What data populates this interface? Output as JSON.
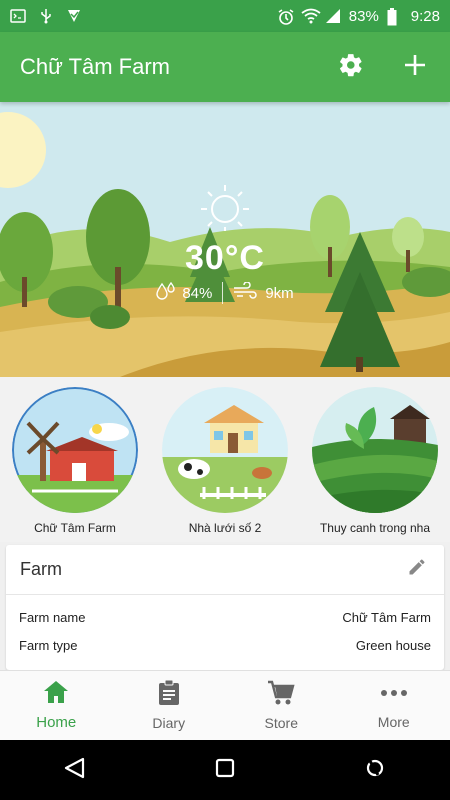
{
  "status_bar": {
    "battery": "83%",
    "time": "9:28",
    "icons": [
      "terminal-icon",
      "usb-icon",
      "download-check-icon",
      "alarm-icon",
      "wifi-icon",
      "signal-icon",
      "battery-icon"
    ]
  },
  "app_bar": {
    "title": "Chữ Tâm Farm",
    "actions": [
      "settings-icon",
      "add-icon"
    ]
  },
  "weather": {
    "temperature": "30°C",
    "humidity": "84%",
    "wind": "9km",
    "condition_icon": "sun-icon"
  },
  "farms": [
    {
      "label": "Chữ Tâm Farm"
    },
    {
      "label": "Nhà lưới số 2"
    },
    {
      "label": "Thuy canh trong nha"
    }
  ],
  "farm_panel": {
    "title": "Farm",
    "rows": [
      {
        "label": "Farm name",
        "value": "Chữ Tâm Farm"
      },
      {
        "label": "Farm type",
        "value": "Green house"
      }
    ]
  },
  "bottom_nav": [
    {
      "label": "Home",
      "icon": "home-icon",
      "active": true
    },
    {
      "label": "Diary",
      "icon": "clipboard-icon",
      "active": false
    },
    {
      "label": "Store",
      "icon": "cart-icon",
      "active": false
    },
    {
      "label": "More",
      "icon": "more-icon",
      "active": false
    }
  ],
  "colors": {
    "primary": "#4caf50",
    "status_bar": "#3aa14a",
    "active_nav": "#3aa14a"
  }
}
